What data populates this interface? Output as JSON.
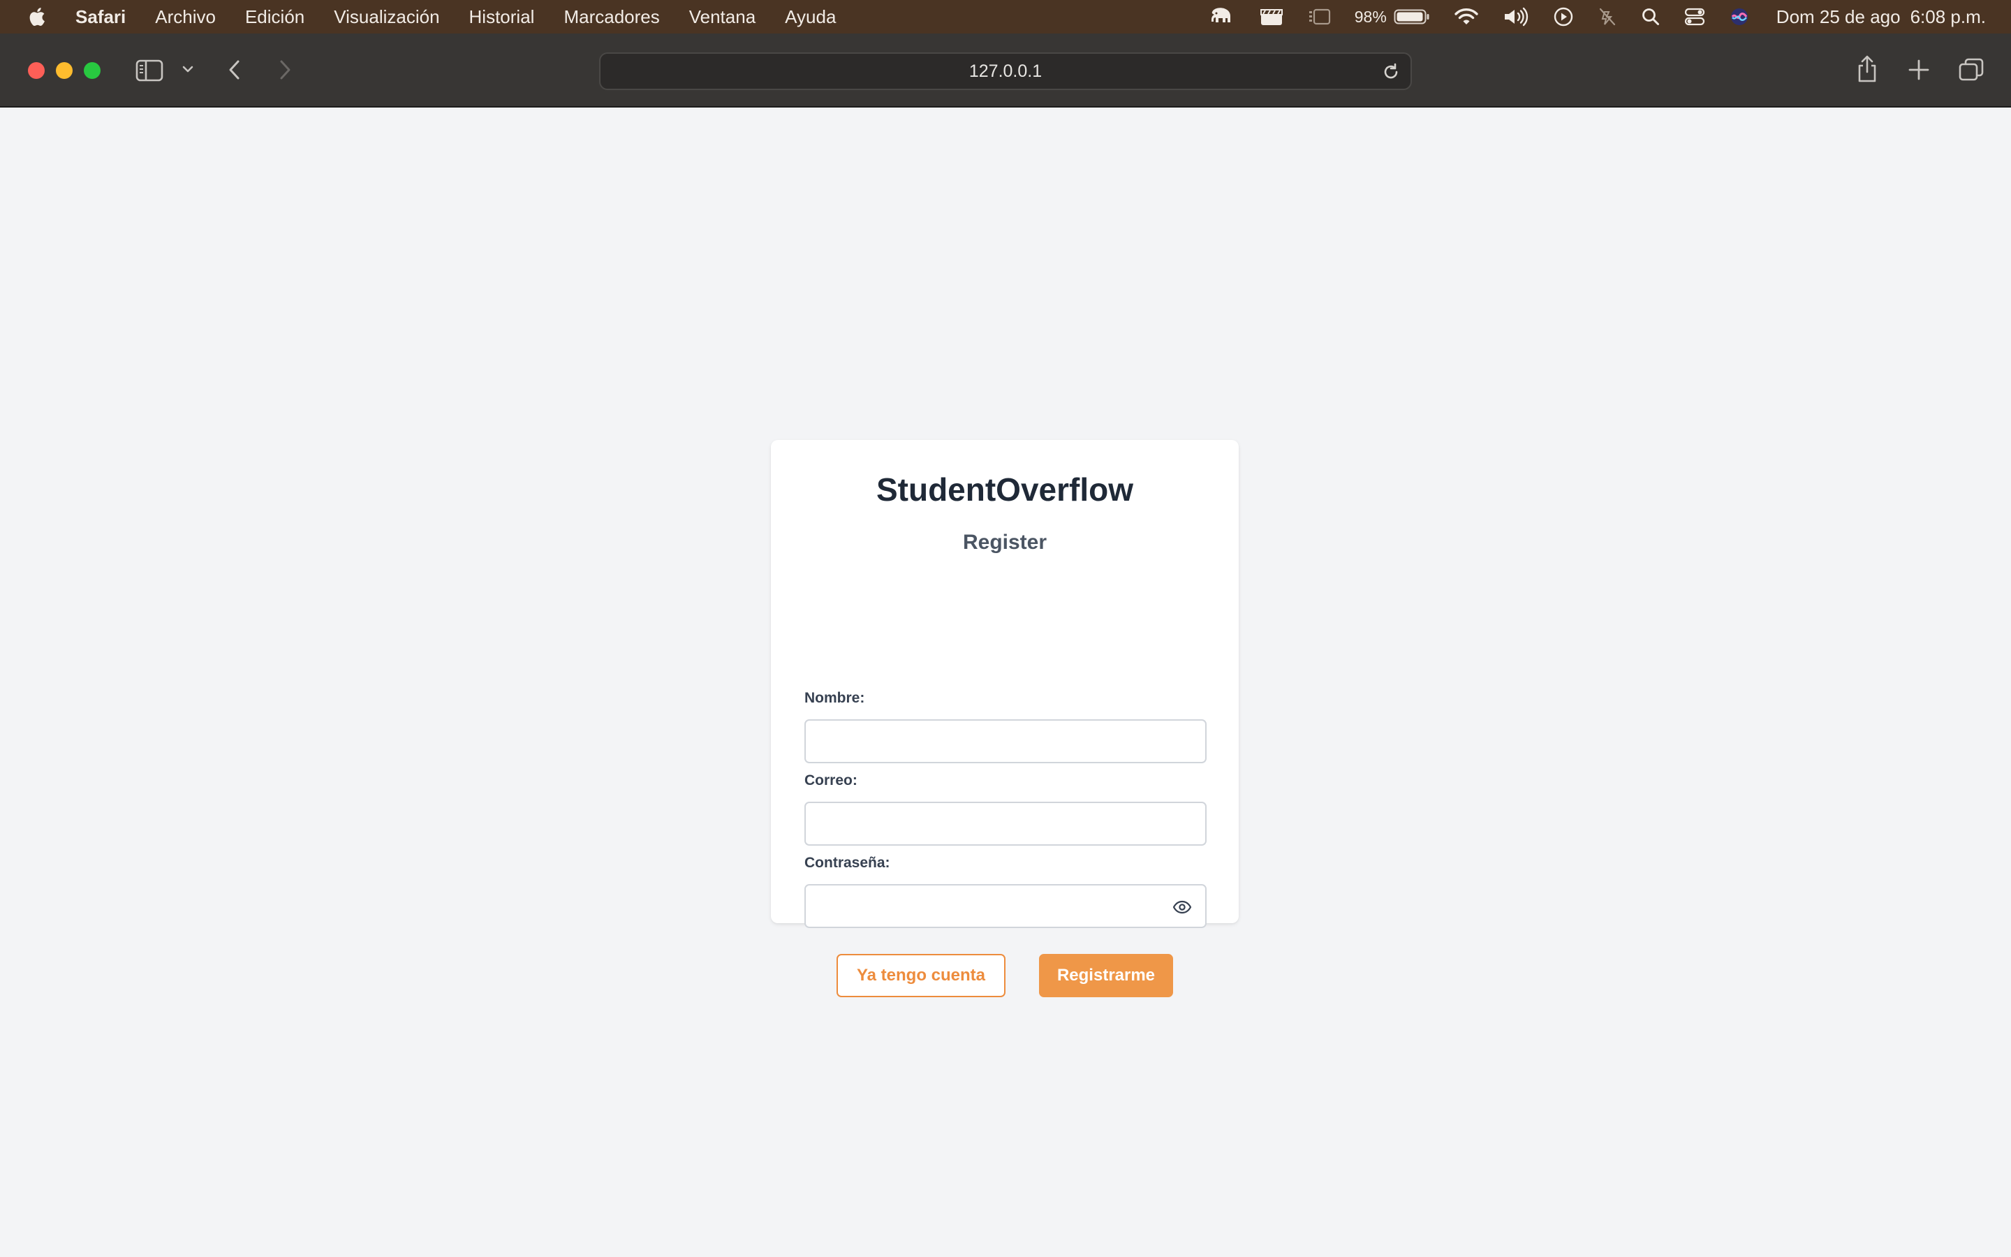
{
  "menubar": {
    "app_name": "Safari",
    "items": [
      "Archivo",
      "Edición",
      "Visualización",
      "Historial",
      "Marcadores",
      "Ventana",
      "Ayuda"
    ],
    "battery_percent": "98%",
    "date": "Dom 25 de ago",
    "time": "6:08 p.m."
  },
  "browser": {
    "url": "127.0.0.1"
  },
  "form": {
    "brand": "StudentOverflow",
    "title": "Register",
    "name_label": "Nombre:",
    "name_value": "",
    "email_label": "Correo:",
    "email_value": "",
    "password_label": "Contraseña:",
    "password_value": "",
    "login_button": "Ya tengo cuenta",
    "register_button": "Registrarme"
  },
  "colors": {
    "accent": "#ef9748",
    "menubar": "#4a3423",
    "page_bg": "#f3f4f6"
  },
  "icons": {
    "apple": "apple-icon",
    "sidebar": "sidebar-icon",
    "back": "chevron-left-icon",
    "forward": "chevron-right-icon",
    "reload": "reload-icon",
    "share": "share-icon",
    "new_tab": "plus-icon",
    "tabs": "tab-overview-icon",
    "password_toggle": "eye-icon"
  }
}
